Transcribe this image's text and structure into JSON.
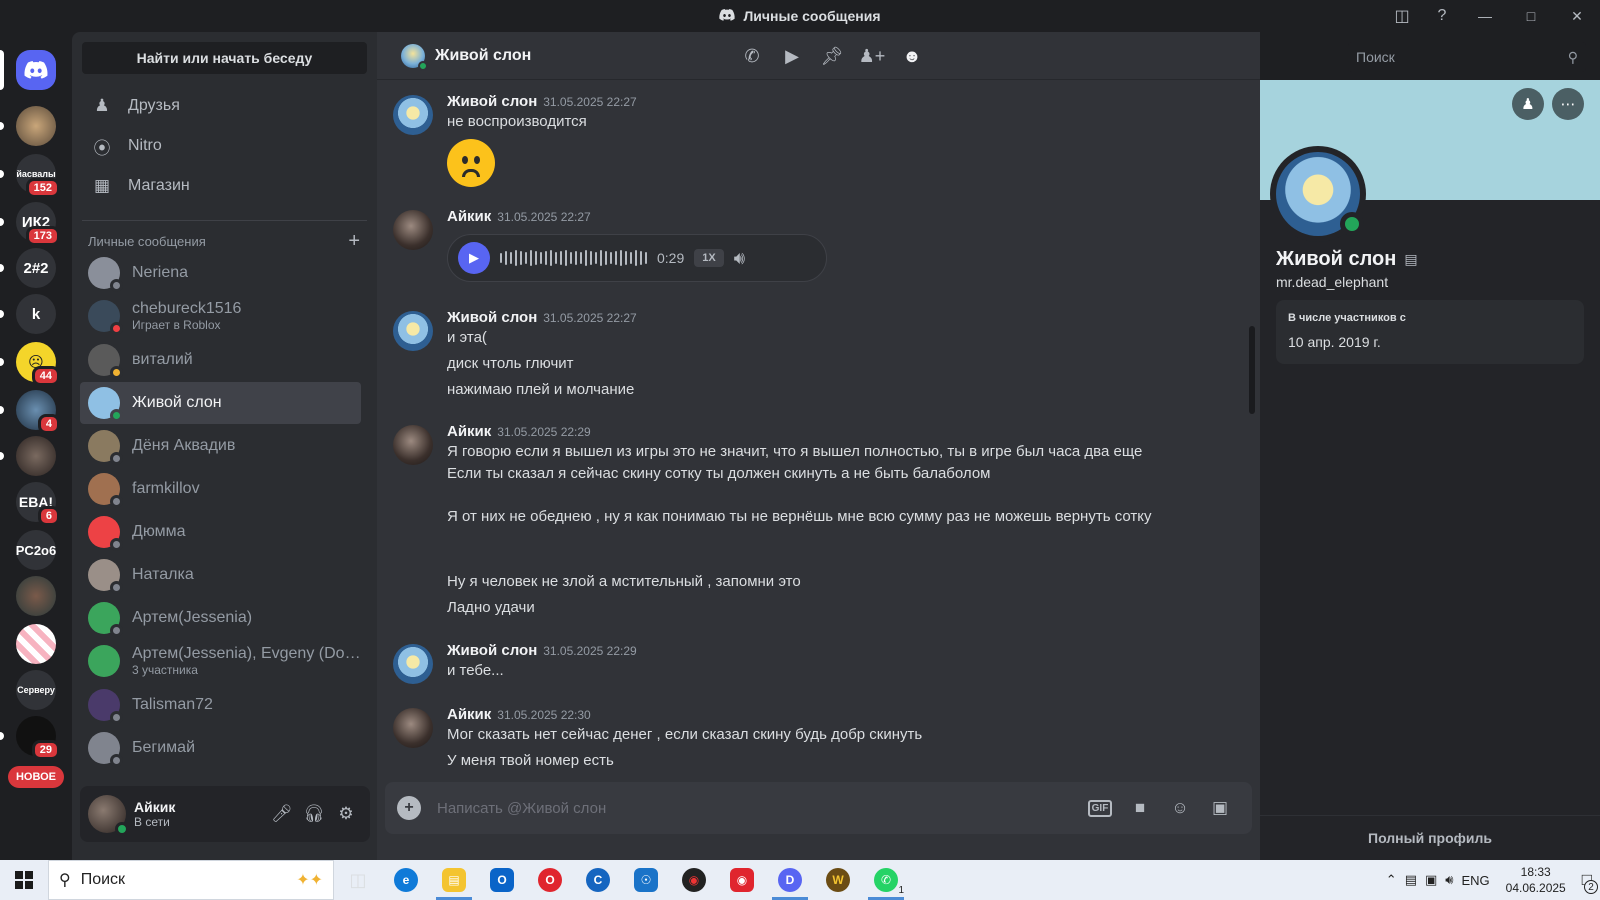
{
  "window": {
    "title": "Личные сообщения"
  },
  "servers": [
    {
      "label": "",
      "badge": ""
    },
    {
      "label": "йасвалы",
      "badge": "152"
    },
    {
      "label": "ИК2",
      "badge": "173"
    },
    {
      "label": "2#2",
      "badge": ""
    },
    {
      "label": "k",
      "badge": ""
    },
    {
      "label": "",
      "badge": "44"
    },
    {
      "label": "",
      "badge": "4"
    },
    {
      "label": "",
      "badge": ""
    },
    {
      "label": "EBA!",
      "badge": "6"
    },
    {
      "label": "PC2o6",
      "badge": ""
    },
    {
      "label": "",
      "badge": ""
    },
    {
      "label": "",
      "badge": ""
    },
    {
      "label": "Серверу",
      "badge": ""
    },
    {
      "label": "",
      "badge": "29"
    }
  ],
  "new_badge": "НОВОЕ",
  "sidebar": {
    "search_label": "Найти или начать беседу",
    "nav": [
      {
        "label": "Друзья",
        "icon": "friends-icon"
      },
      {
        "label": "Nitro",
        "icon": "nitro-icon"
      },
      {
        "label": "Магазин",
        "icon": "shop-icon"
      }
    ],
    "dm_header": "Личные сообщения",
    "dms": [
      {
        "name": "Neriena",
        "sub": "",
        "status": "offline",
        "color": "#8a8f9a"
      },
      {
        "name": "chebureck1516",
        "sub": "Играет в Roblox",
        "status": "dnd",
        "color": "#3a4a5a"
      },
      {
        "name": "виталий",
        "sub": "",
        "status": "idle",
        "color": "#5a5a5a"
      },
      {
        "name": "Живой слон",
        "sub": "",
        "status": "online",
        "color": "#8fc0e4"
      },
      {
        "name": "Дёня Аквадив",
        "sub": "",
        "status": "offline",
        "color": "#8a7a60"
      },
      {
        "name": "farmkillov",
        "sub": "",
        "status": "offline",
        "color": "#a07050"
      },
      {
        "name": "Дюмма",
        "sub": "",
        "status": "offline",
        "color": "#ed4245"
      },
      {
        "name": "Наталка",
        "sub": "",
        "status": "offline",
        "color": "#9a8f88"
      },
      {
        "name": "Артем(Jessenia)",
        "sub": "",
        "status": "offline",
        "color": "#3ba55c"
      },
      {
        "name": "Артем(Jessenia), Evgeny (Dou...",
        "sub": "3 участника",
        "status": "none",
        "color": "#3ba55c"
      },
      {
        "name": "Talisman72",
        "sub": "",
        "status": "offline",
        "color": "#4a3a6a"
      },
      {
        "name": "Бегимай",
        "sub": "",
        "status": "offline",
        "color": "#80848e"
      }
    ]
  },
  "user": {
    "name": "Айкик",
    "status": "В сети"
  },
  "chat": {
    "name": "Живой слон",
    "search_placeholder": "Поиск",
    "composer_placeholder": "Написать @Живой слон",
    "messages": [
      {
        "author": "Живой слон",
        "time": "31.05.2025 22:27",
        "lines": [
          "не воспроизводится"
        ],
        "emoji": "frowning-face"
      },
      {
        "author": "Айкик",
        "time": "31.05.2025 22:27",
        "voice": {
          "duration": "0:29",
          "speed": "1X"
        }
      },
      {
        "author": "Живой слон",
        "time": "31.05.2025 22:27",
        "lines": [
          "и эта(",
          "диск чтоль глючит",
          "нажимаю плей и молчание"
        ]
      },
      {
        "author": "Айкик",
        "time": "31.05.2025 22:29",
        "lines": [
          "Я говорю если я вышел из игры это не значит, что я вышел полностью, ты в игре был часа два еще",
          "Если ты сказал я сейчас скину сотку ты должен скинуть а не быть балаболом",
          "Я от них не обеднею , ну я как понимаю ты не вернёшь мне всю сумму раз не можешь вернуть сотку",
          "Ну я человек не злой а мстительный , запомни это",
          "Ладно удачи"
        ]
      },
      {
        "author": "Живой слон",
        "time": "31.05.2025 22:29",
        "lines": [
          "и тебе..."
        ]
      },
      {
        "author": "Айкик",
        "time": "31.05.2025 22:30",
        "lines": [
          "Мог сказать нет сейчас денег , если сказал скину будь добр скинуть",
          "У меня твой номер есть"
        ]
      }
    ]
  },
  "profile": {
    "name": "Живой слон",
    "handle": "mr.dead_elephant",
    "member_since_label": "В числе участников с",
    "member_since": "10 апр. 2019 г.",
    "full_profile": "Полный профиль"
  },
  "taskbar": {
    "search": "Поиск",
    "lang": "ENG",
    "time": "18:33",
    "date": "04.06.2025",
    "notif_count": "2",
    "whatsapp_badge": "1"
  },
  "colors": {
    "accent": "#5865f2",
    "online": "#23a55a",
    "dnd": "#f23f43",
    "badge": "#da373c"
  }
}
